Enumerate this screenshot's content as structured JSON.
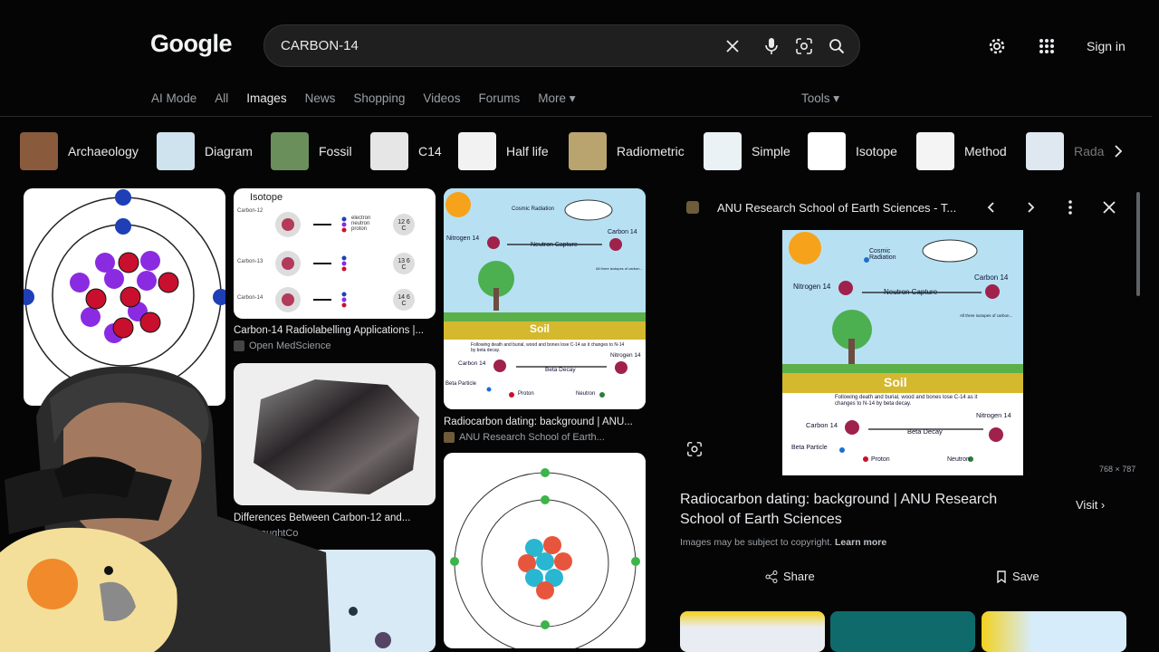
{
  "header": {
    "logo": "Google",
    "query": "CARBON-14",
    "signin": "Sign in",
    "icons": [
      "clear-icon",
      "mic-icon",
      "lens-icon",
      "search-icon",
      "settings-icon",
      "apps-icon"
    ]
  },
  "tabs": [
    {
      "label": "AI Mode"
    },
    {
      "label": "All"
    },
    {
      "label": "Images",
      "active": true
    },
    {
      "label": "News"
    },
    {
      "label": "Shopping"
    },
    {
      "label": "Videos"
    },
    {
      "label": "Forums"
    },
    {
      "label": "More ▾"
    }
  ],
  "tools": "Tools ▾",
  "chips": [
    {
      "label": "Archaeology",
      "color": "#8a5a3c"
    },
    {
      "label": "Diagram",
      "color": "#cfe3ef"
    },
    {
      "label": "Fossil",
      "color": "#6b8f5a"
    },
    {
      "label": "C14",
      "color": "#e6e6e6"
    },
    {
      "label": "Half life",
      "color": "#f2f2f2"
    },
    {
      "label": "Radiometric",
      "color": "#b9a46f"
    },
    {
      "label": "Simple",
      "color": "#eaf2f6"
    },
    {
      "label": "Isotope",
      "color": "#ffffff"
    },
    {
      "label": "Method",
      "color": "#f4f4f4"
    },
    {
      "label": "Rada",
      "color": "#dfe8f0"
    }
  ],
  "results": [
    {
      "caption": "Carbon-14 Radiolabelling Applications |...",
      "source": "Open MedScience"
    },
    {
      "caption": "Differences Between Carbon-12 and...",
      "source": "ThoughtCo"
    },
    {
      "caption": "Radiocarbon dating: background | ANU...",
      "source": "ANU Research School of Earth..."
    }
  ],
  "isotope_card": {
    "title": "Isotope",
    "rows": [
      {
        "name": "Carbon-12",
        "symbol": "12 6 C"
      },
      {
        "name": "Carbon-13",
        "symbol": "13 6 C"
      },
      {
        "name": "Carbon-14",
        "symbol": "14 6 C"
      }
    ],
    "legend": [
      "electron",
      "neutron",
      "proton"
    ]
  },
  "diagram": {
    "labels": [
      "Cosmic Radiation",
      "Nitrogen 14",
      "Neutron Capture",
      "Carbon 14",
      "Soil",
      "Carbon 14",
      "Beta Decay",
      "Nitrogen 14",
      "Beta Particle",
      "Proton",
      "Neutron"
    ],
    "note1": "All three isotopes of carbon...",
    "note2": "Following death and burial, wood and bones lose C-14 as it changes to N-14 by beta decay."
  },
  "panel": {
    "source": "ANU Research School of Earth Sciences - T...",
    "dimensions": "768 × 787",
    "title": "Radiocarbon dating: background | ANU Research School of Earth Sciences",
    "visit": "Visit ›",
    "copyright": "Images may be subject to copyright.",
    "learn_more": "Learn more",
    "share": "Share",
    "save": "Save"
  },
  "colors": {
    "accent": "#8ab4f8",
    "background": "#050505",
    "proton": "#c8102e",
    "neutron": "#8a2be2",
    "electron": "#1e3fb5"
  }
}
